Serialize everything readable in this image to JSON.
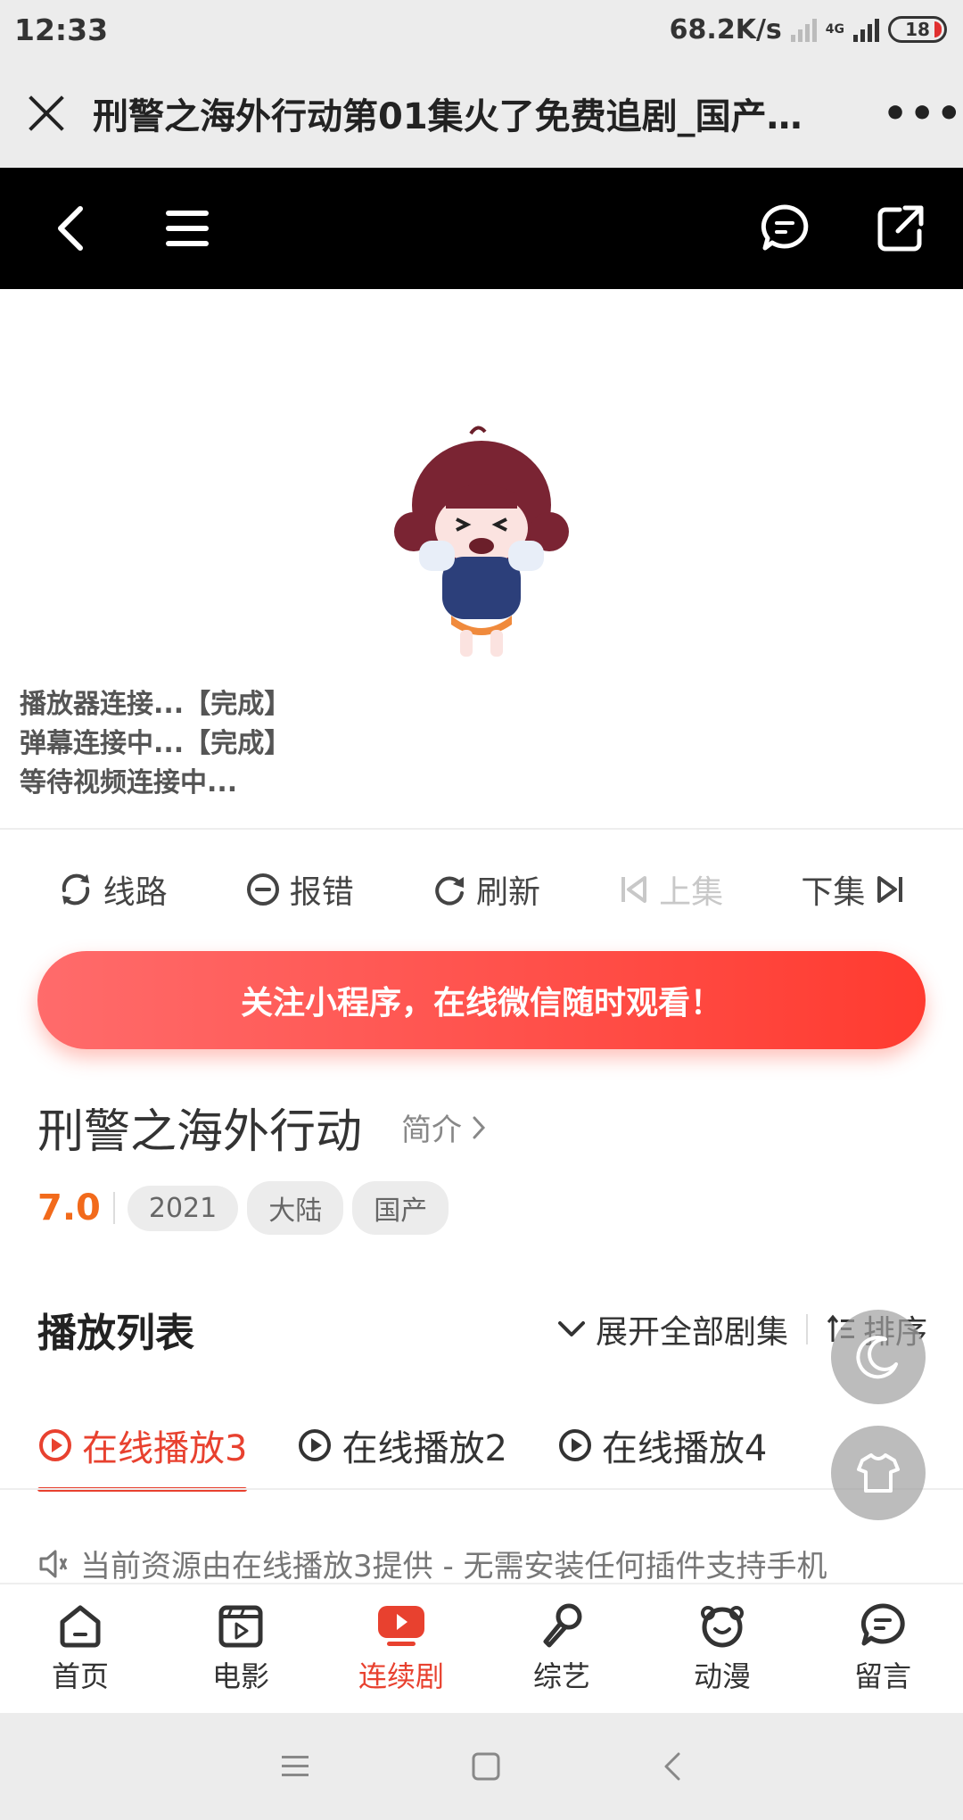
{
  "status_bar": {
    "time": "12:33",
    "speed": "68.2K/s",
    "network": "4G",
    "battery": "18"
  },
  "browser": {
    "title": "刑警之海外行动第01集火了免费追剧_国产…",
    "more": "•••"
  },
  "player": {
    "loading_lines": [
      "播放器连接...【完成】",
      "弹幕连接中...【完成】",
      "等待视频连接中..."
    ]
  },
  "actions": [
    {
      "label": "线路",
      "icon": "refresh-route-icon",
      "enabled": true
    },
    {
      "label": "报错",
      "icon": "minus-circle-icon",
      "enabled": true
    },
    {
      "label": "刷新",
      "icon": "reload-icon",
      "enabled": true
    },
    {
      "label": "上集",
      "icon": "skip-previous-icon",
      "enabled": false
    },
    {
      "label": "下集",
      "icon": "skip-next-icon",
      "enabled": true
    }
  ],
  "banner": {
    "text": "关注小程序，在线微信随时观看！"
  },
  "show": {
    "name": "刑警之海外行动",
    "intro_label": "简介",
    "score": "7.0",
    "tags": [
      "2021",
      "大陆",
      "国产"
    ]
  },
  "playlist": {
    "heading": "播放列表",
    "expand_label": "展开全部剧集",
    "sort_label": "排序",
    "sources": [
      "在线播放3",
      "在线播放2",
      "在线播放4"
    ],
    "active_source": 0,
    "notice": "当前资源由在线播放3提供 - 无需安装任何插件支持手机"
  },
  "bottom_nav": [
    {
      "label": "首页",
      "icon": "home-icon"
    },
    {
      "label": "电影",
      "icon": "film-icon"
    },
    {
      "label": "连续剧",
      "icon": "tv-play-icon"
    },
    {
      "label": "综艺",
      "icon": "microphone-icon"
    },
    {
      "label": "动漫",
      "icon": "bear-icon"
    },
    {
      "label": "留言",
      "icon": "message-icon"
    }
  ],
  "active_bottom_tab": 2,
  "colors": {
    "accent": "#e8412f",
    "score": "#f26a1b",
    "banner_start": "#ff6b6b",
    "banner_end": "#ff3b30"
  }
}
